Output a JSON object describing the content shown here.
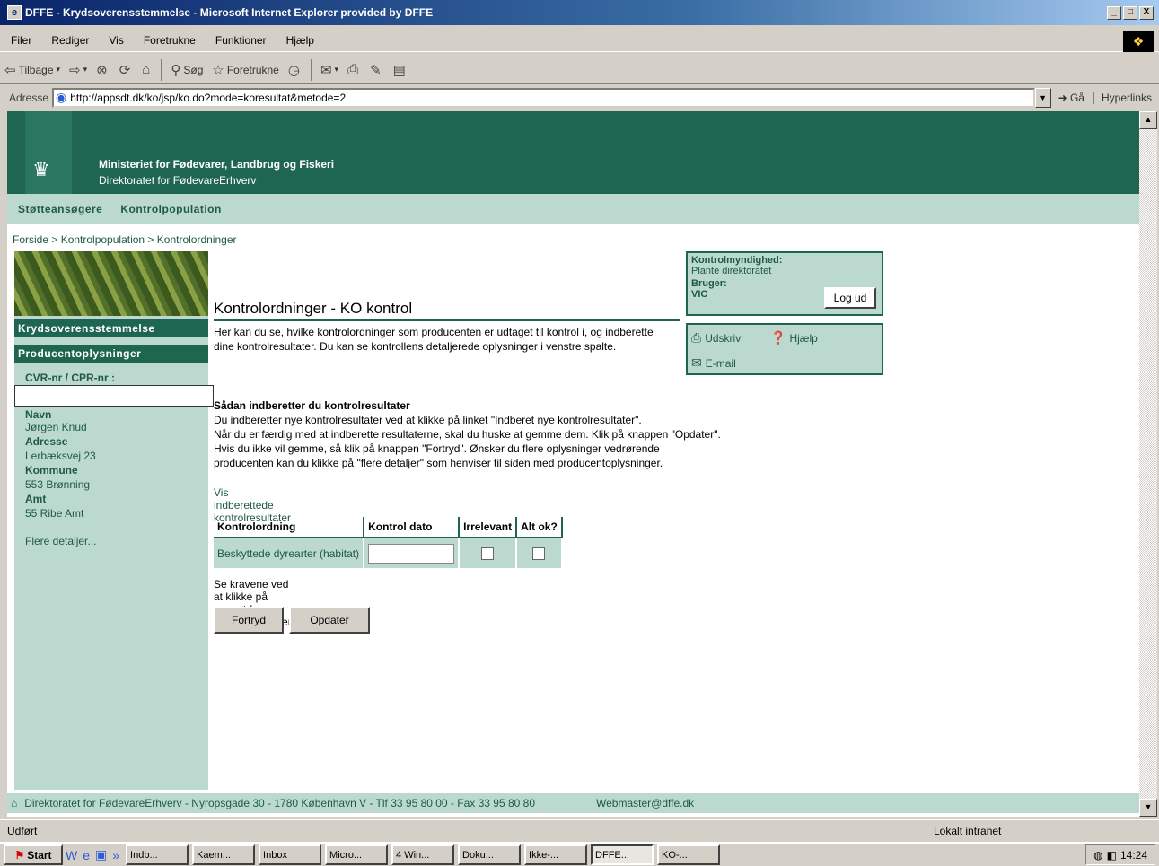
{
  "window": {
    "title": "DFFE - Krydsoverensstemmelse - Microsoft Internet Explorer provided by DFFE",
    "min": "_",
    "max": "□",
    "close": "X"
  },
  "menu": [
    "Filer",
    "Rediger",
    "Vis",
    "Foretrukne",
    "Funktioner",
    "Hjælp"
  ],
  "toolbar": {
    "back": "Tilbage",
    "search": "Søg",
    "favorites": "Foretrukne"
  },
  "address": {
    "label": "Adresse",
    "url": "http://appsdt.dk/ko/jsp/ko.do?mode=koresultat&metode=2",
    "go": "Gå",
    "links": "Hyperlinks"
  },
  "banner": {
    "org_line1": "Ministeriet for Fødevarer, Landbrug og Fiskeri",
    "org_line2": "Direktoratet for FødevareErhverv"
  },
  "nav": [
    "Støtteansøgere",
    "Kontrolpopulation"
  ],
  "breadcrumb": "Forside > Kontrolpopulation > Kontrolordninger",
  "sidebar": {
    "section1": "Krydsoverensstemmelse",
    "section2": "Producentoplysninger",
    "cvr_label": "CVR-nr / CPR-nr :",
    "name_label": "Navn",
    "name_value": "Jørgen Knud",
    "address_label": "Adresse",
    "address_value": "Lerbæksvej 23",
    "municipality_label": "Kommune",
    "municipality_value": "553 Brønning",
    "county_label": "Amt",
    "county_value": "55 Ribe Amt",
    "more_link": "Flere detaljer..."
  },
  "infobox": {
    "title": "Kontrolmyndighed:",
    "value": "Plante direktoratet",
    "user_label": "Bruger:",
    "user_value": "VIC",
    "logout": "Log ud"
  },
  "tools": {
    "print": "Udskriv",
    "help": "Hjælp",
    "email": "E-mail"
  },
  "main": {
    "title": "Kontrolordninger - KO kontrol",
    "intro": "Her kan du se, hvilke kontrolordninger som producenten er udtaget til kontrol i, og indberette dine kontrolresultater. Du kan se kontrollens detaljerede oplysninger i venstre spalte.",
    "hint_title": "Sådan indberetter du kontrolresultater",
    "hint_lines": [
      "Du indberetter nye kontrolresultater ved at klikke på linket \"Indberet nye kontrolresultater\".",
      "Når du er færdig med at indberette resultaterne, skal du huske at gemme dem. Klik på knappen \"Opdater\".",
      "Hvis du ikke vil gemme, så klik på knappen \"Fortryd\". Ønsker du flere oplysninger vedrørende",
      "producenten kan du klikke på \"flere detaljer\" som henviser til siden med producentoplysninger."
    ],
    "show_link": "Vis indberettede kontrolresultater",
    "table": {
      "headers": [
        "Kontrolordning",
        "Kontrol dato",
        "Irrelevant",
        "Alt ok?"
      ],
      "rows": [
        {
          "name": "Beskyttede dyrearter (habitat)",
          "date": "",
          "irrelevant": false,
          "ok": false
        }
      ]
    },
    "after_table": "Se kravene ved at klikke på navnet for kontrolordningen",
    "btn_back": "Fortryd",
    "btn_update": "Opdater"
  },
  "footer": {
    "text": "Direktoratet for FødevareErhverv - Nyropsgade 30 - 1780 København V - Tlf 33 95 80 00 - Fax 33 95 80 80",
    "web": "Webmaster@dffe.dk"
  },
  "status": {
    "left": "Udført",
    "right": "Lokalt intranet"
  },
  "taskbar": {
    "start": "Start",
    "tasks": [
      "Indb...",
      "Kaem...",
      "Inbox",
      "Micro...",
      "4 Win...",
      "Doku...",
      "Ikke-...",
      "DFFE...",
      "KO-..."
    ],
    "clock": "14:24"
  }
}
